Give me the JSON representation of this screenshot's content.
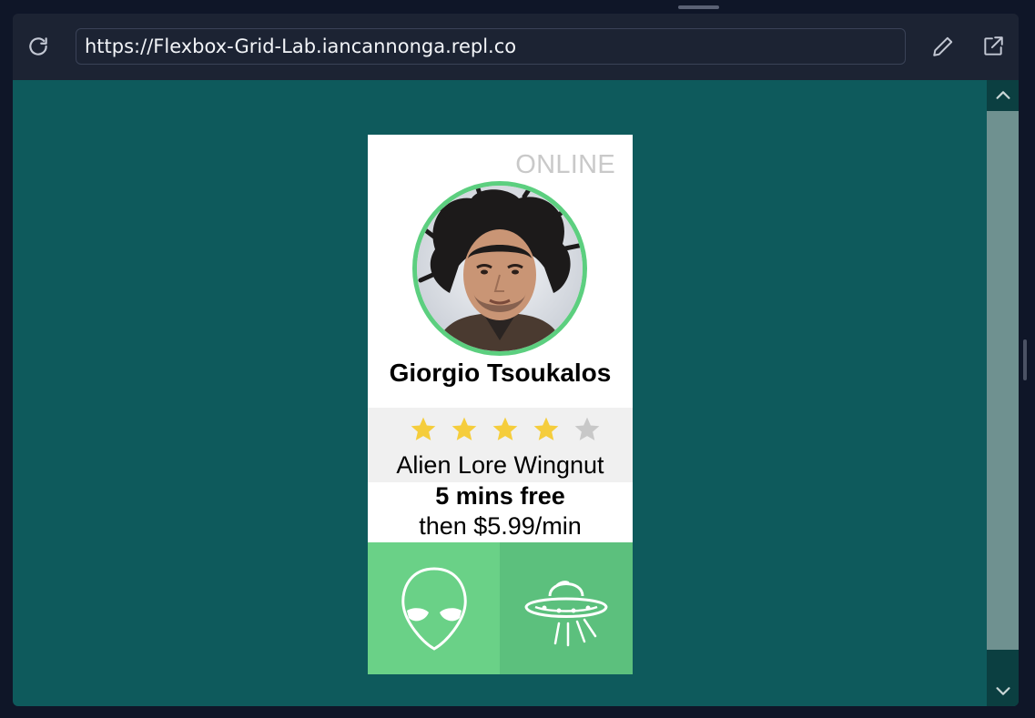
{
  "browser": {
    "url": "https://Flexbox-Grid-Lab.iancannonga.repl.co",
    "icons": {
      "reload": "reload-icon",
      "edit": "pencil-icon",
      "open_external": "external-link-icon",
      "scroll_up": "chevron-up-icon",
      "scroll_down": "chevron-down-icon"
    }
  },
  "card": {
    "status": "ONLINE",
    "name": "Giorgio Tsoukalos",
    "rating": 4,
    "rating_max": 5,
    "title": "Alien Lore Wingnut",
    "price_free": "5 mins free",
    "price_rate": "then $5.99/min",
    "actions": [
      {
        "icon": "alien-head-icon"
      },
      {
        "icon": "ufo-icon"
      }
    ]
  },
  "colors": {
    "page_background": "#0e5a5c",
    "avatar_ring": "#5ccf7f",
    "star_filled": "#f5cd3c",
    "star_empty": "#c8c8c8",
    "action_left_bg": "#6ad187",
    "action_right_bg": "#5cc07d"
  }
}
